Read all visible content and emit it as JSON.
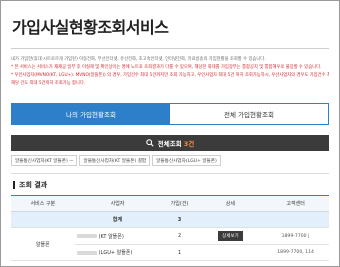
{
  "page": {
    "title": "가입사실현황조회서비스"
  },
  "notice": {
    "line1": "내가 가입한(휴대·시트로르게 가입된) 이동전화, 무선인터넷, 유선전화, 초고속인터넷, 인터넷전화, 유료방송의 가입현황을 조회할 수 있습니다.",
    "line2": "* 본 서비스는 서비스가 재제공 일부 후 이실제 및 확인상이는 명에 노트포 조회결과가 다를 수 있으며, 해당한 화대를 가입장부는 통합공지 및 통합해우로 불장할 수 있습니다.",
    "line3": "* 우인사업자(MVNO(KT, LGU+), MVNO(알뜰폰)) 의 경우, 가입건수 최대 5건까지만 조회 가능하고, 우인사업자 최대 5건 까지 조회가능하시, 우선사업자의 경우도 가입건수 최대 5건까지",
    "line4": "해당 건도 최대 5건까지 조회가능 합니다."
  },
  "tabs": [
    {
      "label": "나의 가입현황조회",
      "active": true
    },
    {
      "label": "전체 가입현황조회",
      "active": false
    }
  ],
  "search_bar": {
    "label": "전체조회",
    "count": "3건"
  },
  "filters": [
    "알뜰통신사업자(KT 알뜰폰) ㅡ",
    "알뜰통신사업자(KT 알뜰폰) 결합",
    "알뜰통신사업자(LGU+ 알뜰폰)"
  ],
  "results": {
    "title": "조회 결과",
    "columns": [
      "서비스 구분",
      "사업자",
      "가입(건)",
      "상세",
      "고객센터"
    ],
    "total": {
      "label": "합계",
      "count": "3"
    },
    "rows": [
      {
        "service": "알뜰폰",
        "carrier": "(KT 알뜰폰)",
        "count": "2",
        "detail": "상세보기",
        "phone": "1899-7700 |"
      },
      {
        "service": "",
        "carrier": "(LGU+ 알뜰폰)",
        "count": "1",
        "detail": "",
        "phone": "1899-7700, 114"
      }
    ]
  },
  "colors": {
    "accent": "#2e7fc9",
    "dark_bar": "#3b3b3b",
    "count_highlight": "#ff8a3d",
    "notice_red": "#d2232a",
    "total_row": "#e3f0fb"
  }
}
